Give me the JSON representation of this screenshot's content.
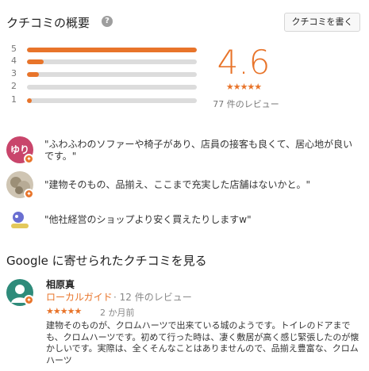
{
  "header": {
    "title": "クチコミの概要",
    "help_glyph": "?",
    "write_button": "クチコミを書く"
  },
  "ratings": {
    "average": "4.6",
    "stars": "★★★★★",
    "count_text": "77 件のレビュー",
    "accent_color": "#e8742a",
    "distribution": [
      {
        "label": "5",
        "fraction": 1.0
      },
      {
        "label": "4",
        "fraction": 0.1
      },
      {
        "label": "3",
        "fraction": 0.07
      },
      {
        "label": "2",
        "fraction": 0.0
      },
      {
        "label": "1",
        "fraction": 0.03
      }
    ]
  },
  "snippets": [
    {
      "avatar_text": "ゆり",
      "text": "\"ふわふわのソファーや椅子があり、店員の接客も良くて、居心地が良いです。\""
    },
    {
      "avatar_text": "",
      "text": "\"建物そのもの、品揃え、ここまで充実した店舗はないかと。\""
    },
    {
      "avatar_text": "",
      "text": "\"他社経営のショップより安く買えたりしますw\""
    }
  ],
  "google_reviews": {
    "title": "Google に寄せられたクチコミを見る",
    "review": {
      "name": "相原真",
      "local_guide": "ローカルガイド",
      "review_count": "· 12 件のレビュー",
      "stars": "★★★★★",
      "date": "2 か月前",
      "body": "建物そのものが、クロムハーツで出来ている城のようです。トイレのドアまでも、クロムハーツです。初めて行った時は、凄く敷居が高く感じ緊張したのが懐かしいです。実際は、全くそんなことはありませんので、品揃え豊富な、クロムハーツ"
    }
  }
}
